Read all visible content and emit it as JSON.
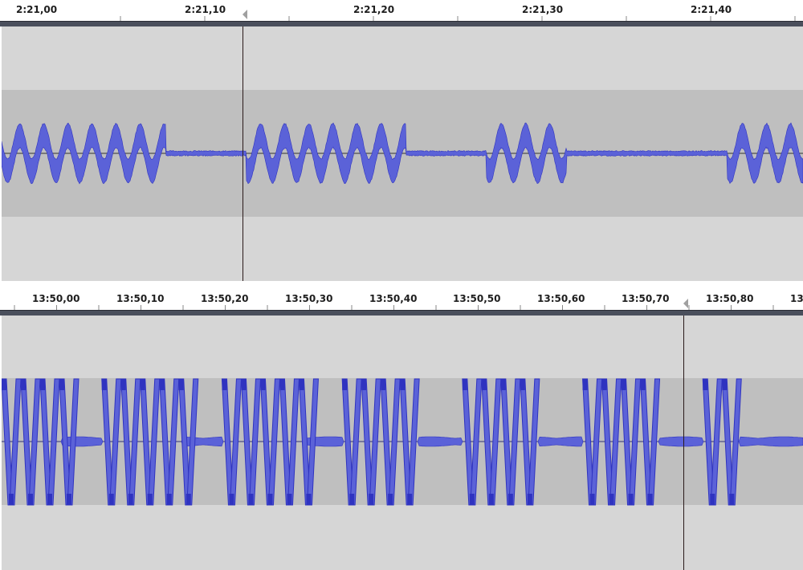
{
  "colors": {
    "waveform": "#5b62d8",
    "waveform_dark": "#2f33c0",
    "track_bg": "#d6d6d6",
    "track_band": "#bfbfbf",
    "ruler_bar": "#4a4f5c",
    "cursor": "#2a1a1a"
  },
  "panels": [
    {
      "ruler": {
        "tick_labels": [
          "2:21,00",
          "2:21,10",
          "2:21,20",
          "2:21,30",
          "2:21,40"
        ]
      },
      "track": {
        "signal": "tone-bursts",
        "bursts": [
          [
            0.0,
            0.205
          ],
          [
            0.305,
            0.505
          ],
          [
            0.605,
            0.705
          ],
          [
            0.905,
            1.0
          ]
        ],
        "cursor_position": 0.3
      }
    },
    {
      "ruler": {
        "tick_labels": [
          "13:50,00",
          "13:50,10",
          "13:50,20",
          "13:50,30",
          "13:50,40",
          "13:50,50",
          "13:50,60",
          "13:50,70",
          "13:50,80",
          "13"
        ]
      },
      "track": {
        "signal": "clipped-bursts",
        "bursts": [
          [
            0.0,
            0.075
          ],
          [
            0.125,
            0.225
          ],
          [
            0.275,
            0.375
          ],
          [
            0.425,
            0.52
          ],
          [
            0.575,
            0.67
          ],
          [
            0.725,
            0.82
          ],
          [
            0.875,
            0.92
          ]
        ],
        "cursor_position": 0.85
      }
    }
  ]
}
